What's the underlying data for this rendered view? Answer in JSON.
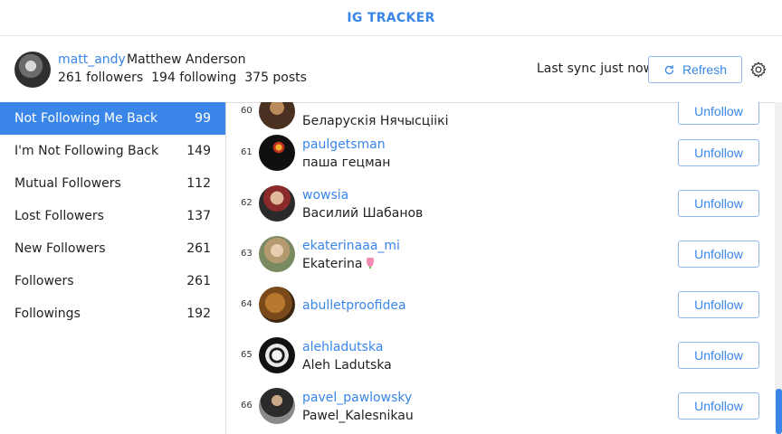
{
  "app": {
    "title": "IG TRACKER"
  },
  "profile": {
    "username": "matt_andy",
    "full_name": "Matthew Anderson",
    "followers": "261 followers",
    "following": "194 following",
    "posts": "375 posts",
    "sync_status": "Last sync just now",
    "refresh_label": "Refresh"
  },
  "sidebar": {
    "items": [
      {
        "label": "Not Following Me Back",
        "count": "99",
        "active": true
      },
      {
        "label": "I'm Not Following Back",
        "count": "149"
      },
      {
        "label": "Mutual Followers",
        "count": "112"
      },
      {
        "label": "Lost Followers",
        "count": "137"
      },
      {
        "label": "New Followers",
        "count": "261"
      },
      {
        "label": "Followers",
        "count": "261"
      },
      {
        "label": "Followings",
        "count": "192"
      }
    ]
  },
  "list": {
    "action_label": "Unfollow",
    "rows": [
      {
        "index": "60",
        "username": "",
        "full_name": "Беларускія Нячысціікі"
      },
      {
        "index": "61",
        "username": "paulgetsman",
        "full_name": "паша гецман"
      },
      {
        "index": "62",
        "username": "wowsia",
        "full_name": "Василий Шабанов"
      },
      {
        "index": "63",
        "username": "ekaterinaaa_mi",
        "full_name": "Ekaterina"
      },
      {
        "index": "64",
        "username": "abulletproofidea",
        "full_name": ""
      },
      {
        "index": "65",
        "username": "alehladutska",
        "full_name": "Aleh Ladutska"
      },
      {
        "index": "66",
        "username": "pavel_pawlowsky",
        "full_name": "Pawel_Kalesnikau"
      }
    ]
  },
  "colors": {
    "accent": "#3a86e8",
    "active_bg": "#3a86e8"
  },
  "icons": {
    "refresh": "refresh-icon",
    "settings": "gear-icon"
  }
}
